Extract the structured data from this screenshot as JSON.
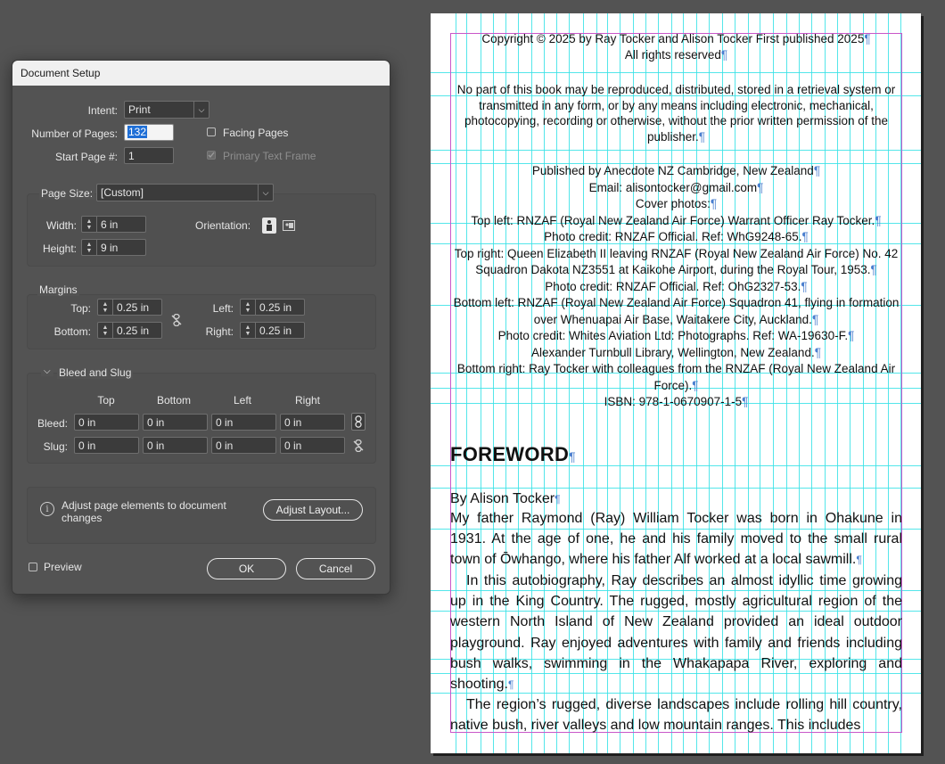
{
  "dialog": {
    "title": "Document Setup",
    "intent": {
      "label": "Intent:",
      "value": "Print"
    },
    "pages": {
      "label": "Number of Pages:",
      "value": "132"
    },
    "start_page": {
      "label": "Start Page #:",
      "value": "1"
    },
    "facing_pages": {
      "label": "Facing Pages",
      "checked": false
    },
    "primary_text_frame": {
      "label": "Primary Text Frame",
      "checked": true,
      "disabled": true
    },
    "page_size": {
      "label": "Page Size:",
      "value": "[Custom]"
    },
    "width": {
      "label": "Width:",
      "value": "6 in"
    },
    "height": {
      "label": "Height:",
      "value": "9 in"
    },
    "orientation": {
      "label": "Orientation:"
    },
    "margins": {
      "title": "Margins",
      "top": {
        "label": "Top:",
        "value": "0.25 in"
      },
      "bottom": {
        "label": "Bottom:",
        "value": "0.25 in"
      },
      "left": {
        "label": "Left:",
        "value": "0.25 in"
      },
      "right": {
        "label": "Right:",
        "value": "0.25 in"
      }
    },
    "bleed_slug": {
      "title": "Bleed and Slug",
      "headers": [
        "Top",
        "Bottom",
        "Left",
        "Right"
      ],
      "bleed": {
        "label": "Bleed:",
        "values": [
          "0 in",
          "0 in",
          "0 in",
          "0 in"
        ]
      },
      "slug": {
        "label": "Slug:",
        "values": [
          "0 in",
          "0 in",
          "0 in",
          "0 in"
        ]
      }
    },
    "adjust": {
      "text": "Adjust page elements to document changes",
      "button": "Adjust Layout..."
    },
    "preview": {
      "label": "Preview",
      "checked": false
    },
    "ok": "OK",
    "cancel": "Cancel"
  },
  "page": {
    "copyright": [
      "Copyright © 2025 by Ray Tocker and Alison Tocker First published 2025",
      "All rights reserved"
    ],
    "rights": "No part of this book may be reproduced, distributed, stored in a retrieval system or transmitted in any form, or by any means including electronic, mechanical, photocopying, recording or otherwise, without the prior written permission of the publisher.",
    "credits": [
      "Published by Anecdote NZ Cambridge, New Zealand",
      "Email: alisontocker@gmail.com",
      "Cover photos:",
      "Top left: RNZAF (Royal New Zealand Air Force) Warrant Officer Ray Tocker.",
      "Photo credit: RNZAF Official. Ref: WhG9248-65.",
      "Top right: Queen Elizabeth II leaving RNZAF (Royal New Zealand Air Force) No. 42 Squadron Dakota NZ3551 at Kaikohe Airport, during the Royal Tour, 1953.",
      "Photo credit: RNZAF Official. Ref: OhG2327-53.",
      "Bottom left: RNZAF (Royal New Zealand Air Force) Squadron 41, flying in formation over Whenuapai Air Base, Waitakere City, Auckland.",
      "Photo credit: Whites Aviation Ltd: Photographs. Ref: WA-19630-F.",
      "Alexander Turnbull Library, Wellington, New Zealand.",
      "Bottom right: Ray Tocker with colleagues from the RNZAF (Royal New Zealand Air Force).",
      "ISBN: 978-1-0670907-1-5"
    ],
    "heading": "FOREWORD",
    "byline": "By Alison Tocker",
    "paragraphs": [
      "My father Raymond (Ray) William Tocker was born in Ohakune in 1931. At the age of one, he and his family moved to the small rural town of Ōwhango, where his father Alf worked at a local sawmill.",
      "In this autobiography, Ray describes an almost idyllic time growing up in the King Country. The rugged, mostly agricultural region of the western North Island of New Zealand provided an ideal outdoor playground. Ray enjoyed adventures with family and friends including bush walks, swimming in the Whakapapa River, exploring and shooting.",
      "The region’s rugged, diverse landscapes include rolling hill country, native bush, river valleys and low mountain ranges. This includes"
    ]
  }
}
